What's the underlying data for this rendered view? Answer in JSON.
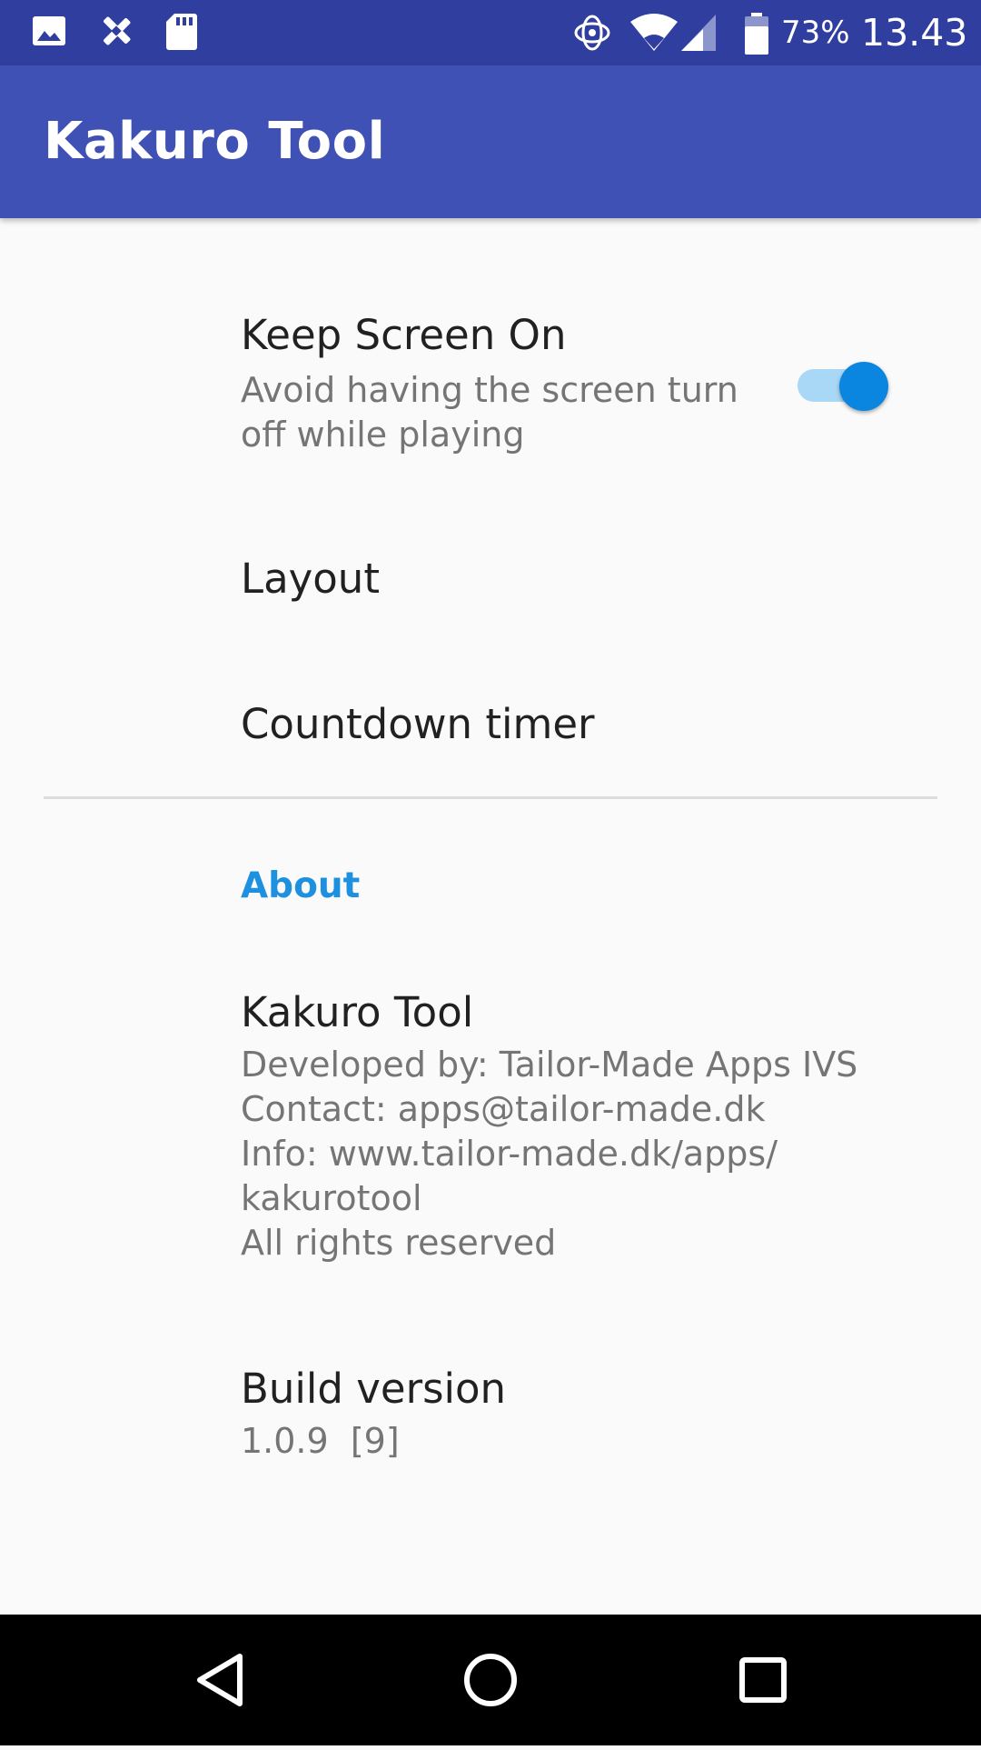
{
  "status_bar": {
    "left_icons": [
      "image-icon",
      "tools-icon",
      "sd-card-icon"
    ],
    "right_icons": [
      "sync-icon",
      "wifi-icon",
      "signal-icon",
      "battery-icon"
    ],
    "battery_percent": "73%",
    "time": "13.43"
  },
  "app_bar": {
    "title": "Kakuro Tool"
  },
  "preferences": {
    "keep_screen_on": {
      "title": "Keep Screen On",
      "summary_lines": [
        "Avoid having the screen turn",
        "off while playing"
      ],
      "enabled": true
    },
    "layout": {
      "title": "Layout"
    },
    "countdown_timer": {
      "title": "Countdown timer"
    }
  },
  "about": {
    "category_label": "About",
    "app_info": {
      "title": "Kakuro Tool",
      "summary_lines": [
        "Developed by: Tailor-Made Apps IVS",
        "Contact: apps@tailor-made.dk",
        "Info: www.tailor-made.dk/apps/",
        "kakurotool",
        "All rights reserved"
      ]
    },
    "build_version": {
      "title": "Build version",
      "summary": "1.0.9  [9]"
    }
  },
  "nav_bar": {
    "buttons": [
      "back-icon",
      "home-icon",
      "recents-icon"
    ]
  },
  "colors": {
    "status_bar": "#303f9f",
    "app_bar": "#3f51b5",
    "accent": "#0a86e0",
    "category": "#1e90e0"
  }
}
